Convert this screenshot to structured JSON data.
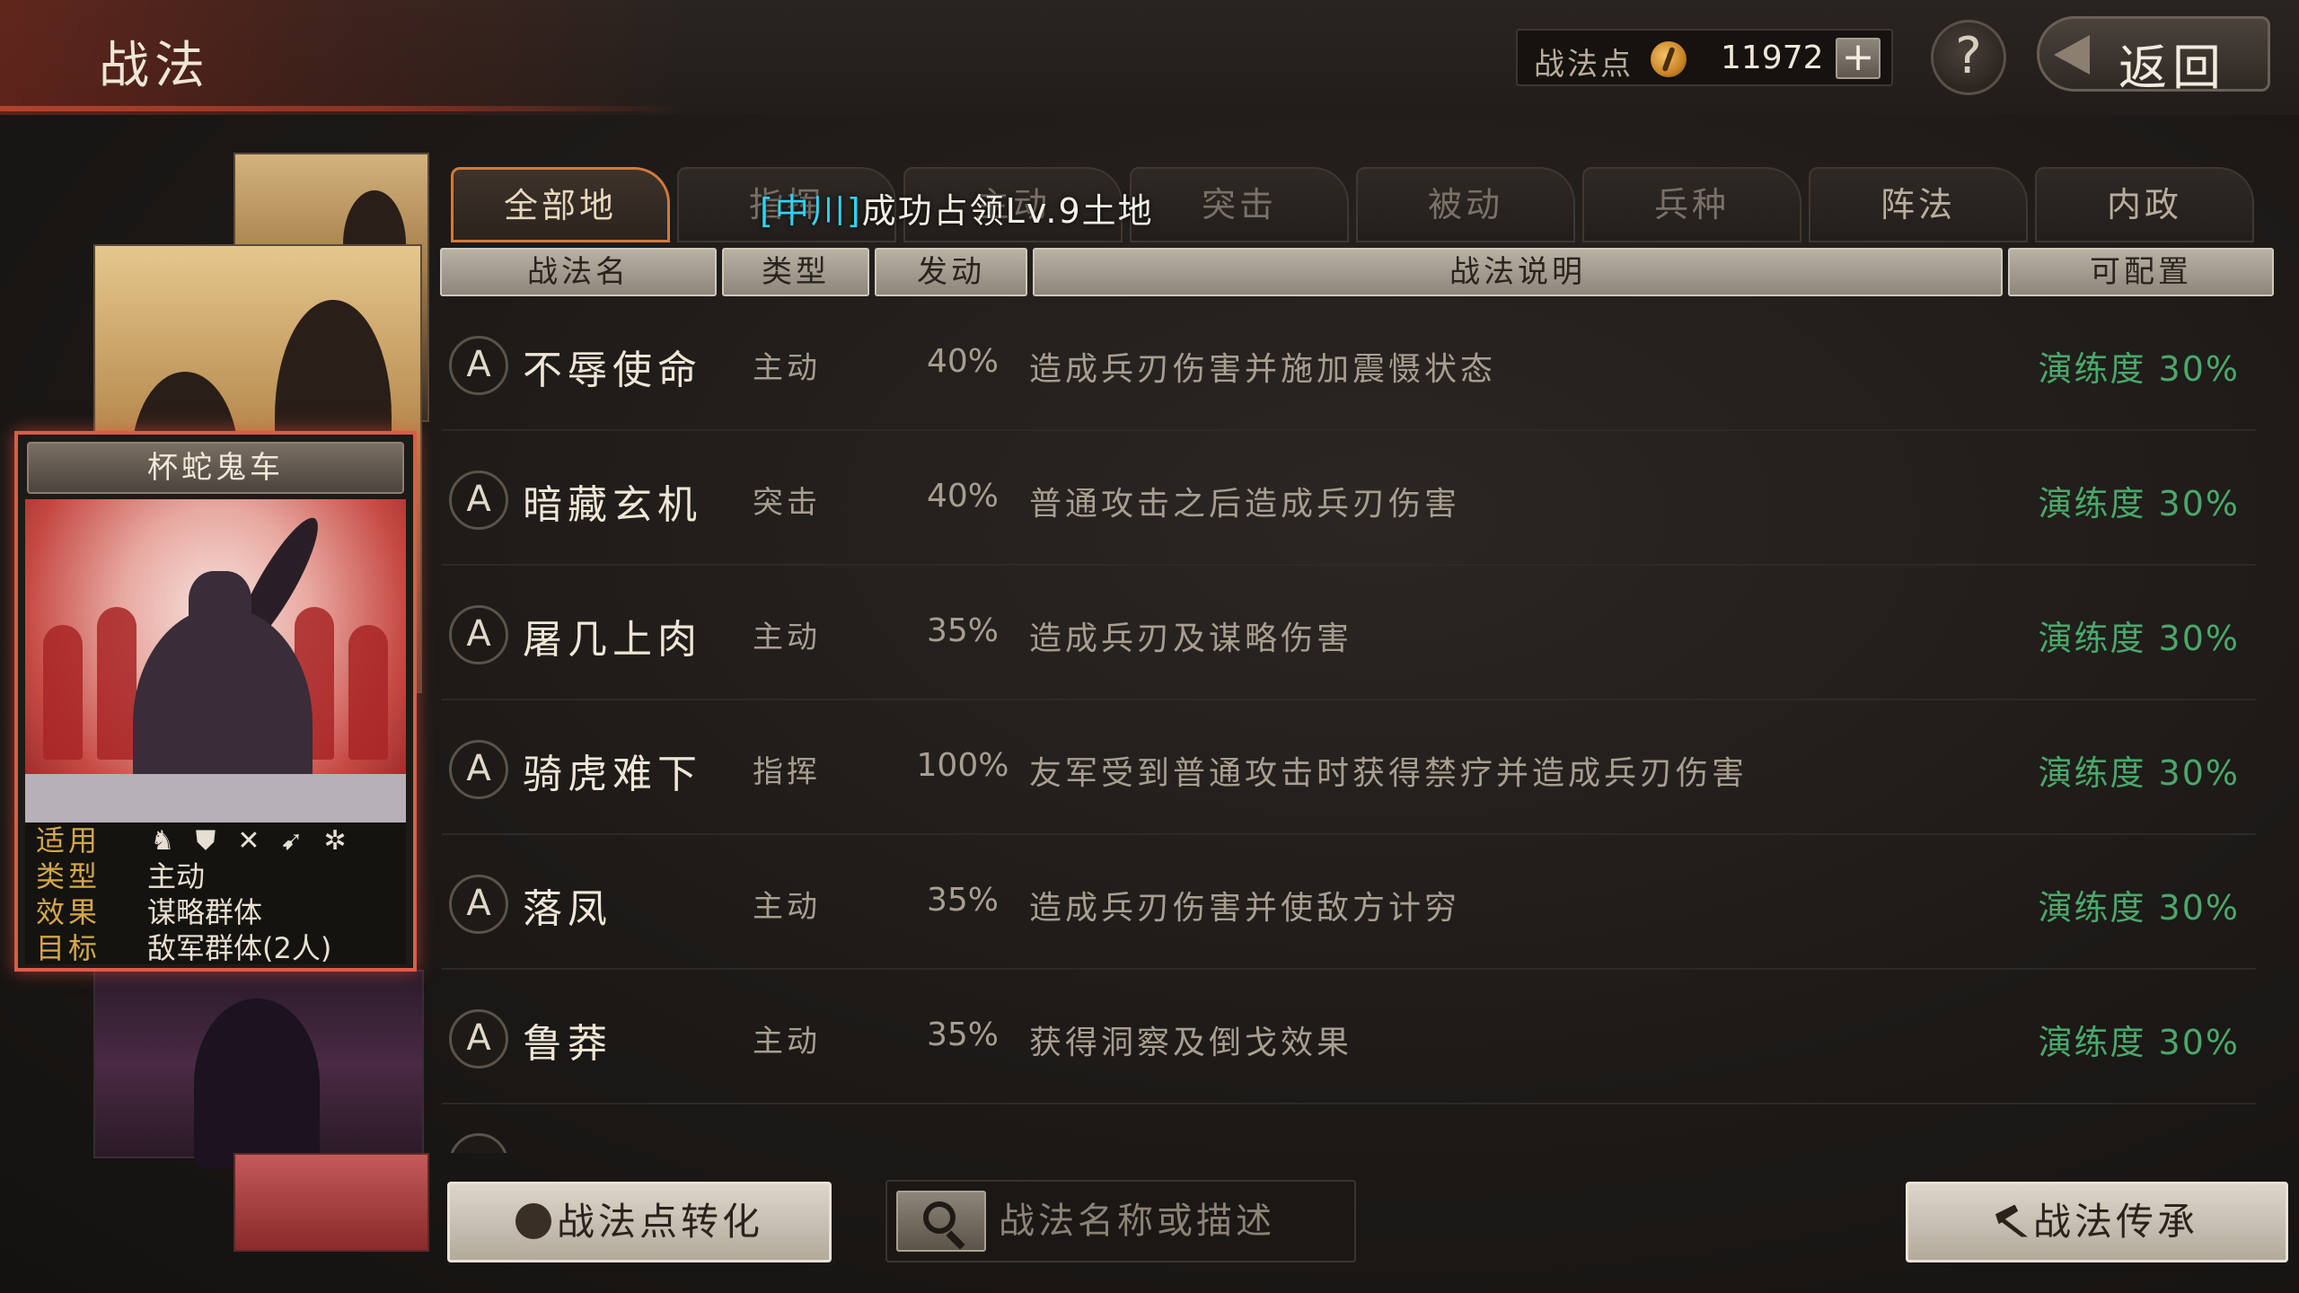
{
  "header": {
    "title": "战法",
    "points_label": "战法点",
    "points_value": "11972",
    "plus_label": "+",
    "help_label": "?",
    "back_label": "返回"
  },
  "selected_card": {
    "name": "杯蛇鬼车",
    "info": [
      {
        "key": "适用",
        "value": ""
      },
      {
        "key": "类型",
        "value": "主动"
      },
      {
        "key": "效果",
        "value": "谋略群体"
      },
      {
        "key": "目标",
        "value": "敌军群体(2人)"
      }
    ],
    "apply_icons": [
      "cavalry-icon",
      "shield-icon",
      "crossed-swords-icon",
      "archer-icon",
      "wheel-icon"
    ]
  },
  "tabs": [
    {
      "label": "全部地",
      "active": true
    },
    {
      "label": "指挥",
      "active": false
    },
    {
      "label": "主动",
      "active": false
    },
    {
      "label": "突击",
      "active": false
    },
    {
      "label": "被动",
      "active": false
    },
    {
      "label": "兵种",
      "active": false
    },
    {
      "label": "阵法",
      "active": false
    },
    {
      "label": "内政",
      "active": false
    }
  ],
  "overlay_banner": {
    "highlight": "[中川]",
    "text": "成功占领Lv.9土地"
  },
  "columns": [
    "战法名",
    "类型",
    "发动",
    "战法说明",
    "可配置"
  ],
  "rows": [
    {
      "grade": "A",
      "name": "不辱使命",
      "type": "主动",
      "chance": "40%",
      "desc": "造成兵刃伤害并施加震慑状态",
      "status": "演练度 30%"
    },
    {
      "grade": "A",
      "name": "暗藏玄机",
      "type": "突击",
      "chance": "40%",
      "desc": "普通攻击之后造成兵刃伤害",
      "status": "演练度 30%"
    },
    {
      "grade": "A",
      "name": "屠几上肉",
      "type": "主动",
      "chance": "35%",
      "desc": "造成兵刃及谋略伤害",
      "status": "演练度 30%"
    },
    {
      "grade": "A",
      "name": "骑虎难下",
      "type": "指挥",
      "chance": "100%",
      "desc": "友军受到普通攻击时获得禁疗并造成兵刃伤害",
      "status": "演练度 30%"
    },
    {
      "grade": "A",
      "name": "落凤",
      "type": "主动",
      "chance": "35%",
      "desc": "造成兵刃伤害并使敌方计穷",
      "status": "演练度 30%"
    },
    {
      "grade": "A",
      "name": "鲁莽",
      "type": "主动",
      "chance": "35%",
      "desc": "获得洞察及倒戈效果",
      "status": "演练度 30%"
    }
  ],
  "bottom": {
    "convert_label": "战法点转化",
    "search_placeholder": "战法名称或描述",
    "inherit_label": "战法传承"
  },
  "colors": {
    "status_green": "#4aa86a",
    "accent_orange": "#d27a3a",
    "card_border_red": "#e05a4a",
    "banner_cyan": "#2fd3f0"
  }
}
